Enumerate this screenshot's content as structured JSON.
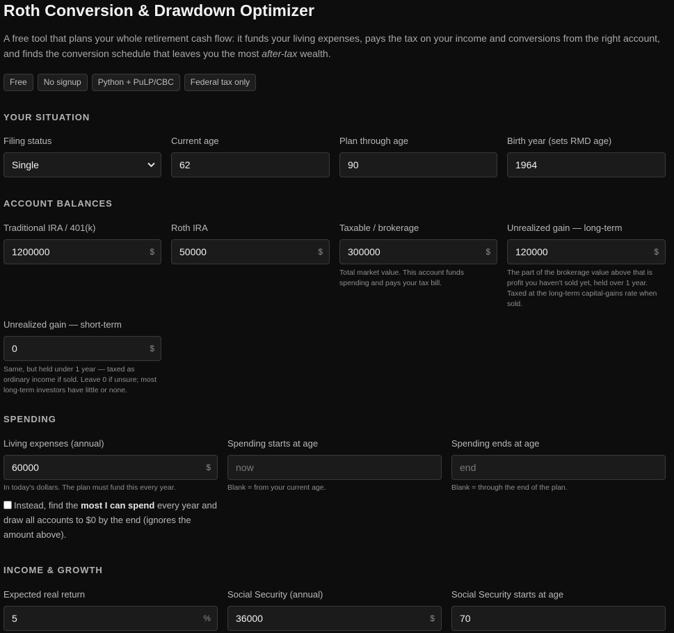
{
  "title": "Roth Conversion & Drawdown Optimizer",
  "intro": {
    "text_before": "A free tool that plans your whole retirement cash flow: it funds your living expenses, pays the tax on your income and conversions from the right account, and finds the conversion schedule that leaves you the most ",
    "emphasis": "after-tax",
    "text_after": " wealth."
  },
  "badges": [
    "Free",
    "No signup",
    "Python + PuLP/CBC",
    "Federal tax only"
  ],
  "sections": {
    "situation": "YOUR SITUATION",
    "balances": "ACCOUNT BALANCES",
    "spending": "SPENDING",
    "income": "INCOME & GROWTH"
  },
  "situation": {
    "filing_status": {
      "label": "Filing status",
      "value": "Single"
    },
    "current_age": {
      "label": "Current age",
      "value": "62"
    },
    "plan_age": {
      "label": "Plan through age",
      "value": "90"
    },
    "birth_year": {
      "label": "Birth year (sets RMD age)",
      "value": "1964"
    }
  },
  "balances": {
    "traditional": {
      "label": "Traditional IRA / 401(k)",
      "value": "1200000",
      "unit": "$"
    },
    "roth": {
      "label": "Roth IRA",
      "value": "50000",
      "unit": "$"
    },
    "taxable": {
      "label": "Taxable / brokerage",
      "value": "300000",
      "unit": "$",
      "help": "Total market value. This account funds spending and pays your tax bill."
    },
    "lt_gain": {
      "label": "Unrealized gain — long-term",
      "value": "120000",
      "unit": "$",
      "help": "The part of the brokerage value above that is profit you haven't sold yet, held over 1 year. Taxed at the long-term capital-gains rate when sold."
    },
    "st_gain": {
      "label": "Unrealized gain — short-term",
      "value": "0",
      "unit": "$",
      "help": "Same, but held under 1 year — taxed as ordinary income if sold. Leave 0 if unsure; most long-term investors have little or none."
    }
  },
  "spending": {
    "expenses": {
      "label": "Living expenses (annual)",
      "value": "60000",
      "unit": "$",
      "help": "In today's dollars. The plan must fund this every year."
    },
    "start": {
      "label": "Spending starts at age",
      "placeholder": "now",
      "help": "Blank = from your current age."
    },
    "end": {
      "label": "Spending ends at age",
      "placeholder": "end",
      "help": "Blank = through the end of the plan."
    },
    "max_spend": {
      "checked": false,
      "before": "Instead, find the ",
      "bold": "most I can spend",
      "after": " every year and draw all accounts to $0 by the end (ignores the amount above)."
    }
  },
  "income": {
    "return": {
      "label": "Expected real return",
      "value": "5",
      "unit": "%"
    },
    "ss": {
      "label": "Social Security (annual)",
      "value": "36000",
      "unit": "$"
    },
    "ss_age": {
      "label": "Social Security starts at age",
      "value": "70"
    }
  }
}
